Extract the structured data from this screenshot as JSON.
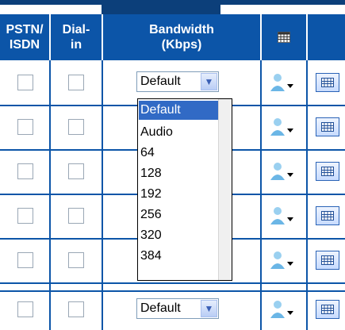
{
  "colors": {
    "header_bg": "#0c55a8",
    "accent": "#316ac5"
  },
  "columns": {
    "pstn": "PSTN/\nISDN",
    "dialin": "Dial-\nin",
    "bandwidth": "Bandwidth\n(Kbps)",
    "calendar_icon": "calendar-grid-icon"
  },
  "rows": [
    {
      "bandwidth_value": "Default"
    },
    {
      "bandwidth_value": ""
    },
    {
      "bandwidth_value": ""
    },
    {
      "bandwidth_value": ""
    },
    {
      "bandwidth_value": ""
    },
    {
      "bandwidth_value": "Default"
    }
  ],
  "dropdown": {
    "selected": "Default",
    "options": [
      "Default",
      "Audio",
      "64",
      "128",
      "192",
      "256",
      "320",
      "384"
    ]
  }
}
